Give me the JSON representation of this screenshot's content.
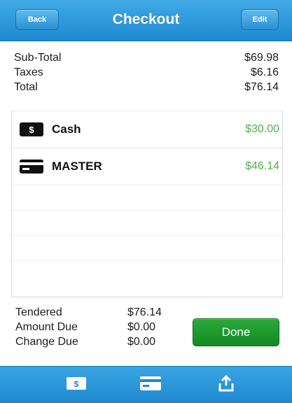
{
  "navbar": {
    "title": "Checkout",
    "back_label": "Back",
    "edit_label": "Edit"
  },
  "totals": [
    {
      "label": "Sub-Total",
      "value": "$69.98"
    },
    {
      "label": "Taxes",
      "value": "$6.16"
    },
    {
      "label": "Total",
      "value": "$76.14"
    }
  ],
  "payments": [
    {
      "label": "Cash",
      "amount": "$30.00",
      "icon": "cash-icon",
      "icon_text": "$"
    },
    {
      "label": "MASTER",
      "amount": "$46.14",
      "icon": "credit-card-icon"
    }
  ],
  "summary": [
    {
      "label": "Tendered",
      "value": "$76.14"
    },
    {
      "label": "Amount Due",
      "value": "$0.00"
    },
    {
      "label": "Change Due",
      "value": "$0.00"
    }
  ],
  "done_label": "Done",
  "toolbar": {
    "cash_icon_text": "$",
    "items": [
      "cash-icon",
      "credit-card-icon",
      "share-icon"
    ]
  },
  "colors": {
    "bar_blue": "#2a97da",
    "amount_green": "#4fb04f",
    "done_green": "#1b9a2c"
  }
}
